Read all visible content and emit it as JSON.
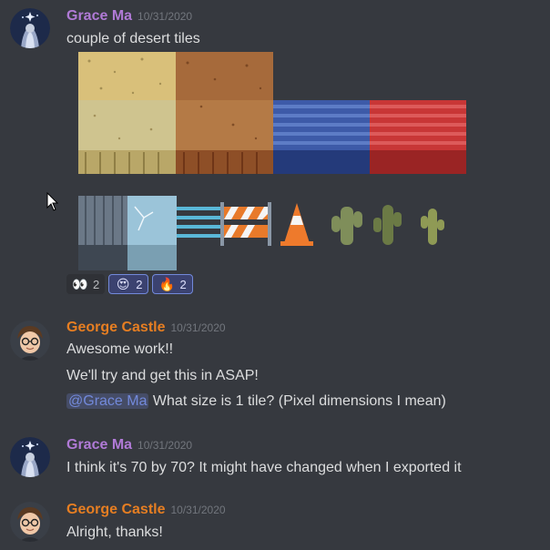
{
  "colors": {
    "background": "#36393f",
    "grace": "#b07ad6",
    "george": "#e67e22",
    "mention": "#7289da",
    "timestamp": "#72767d"
  },
  "messages": [
    {
      "author": "Grace Ma",
      "timestamp": "10/31/2020",
      "lines": [
        "couple of desert tiles"
      ],
      "reactions": [
        {
          "emoji": "eyes-emoji",
          "glyph": "👀",
          "count": "2"
        },
        {
          "emoji": "heart-eyes-emoji",
          "glyph": "😍",
          "count": "2"
        },
        {
          "emoji": "fire-emoji",
          "glyph": "🔥",
          "count": "2"
        }
      ]
    },
    {
      "author": "George Castle",
      "timestamp": "10/31/2020",
      "lines": [
        "Awesome work!!",
        "We'll try and get this in ASAP!"
      ],
      "mention": "@Grace Ma",
      "mention_text": " What size is 1 tile? (Pixel dimensions I mean)"
    },
    {
      "author": "Grace Ma",
      "timestamp": "10/31/2020",
      "lines": [
        "I think it's 70 by 70? It might have changed when I exported it"
      ]
    },
    {
      "author": "George Castle",
      "timestamp": "10/31/2020",
      "lines": [
        "Alright, thanks!"
      ]
    }
  ]
}
